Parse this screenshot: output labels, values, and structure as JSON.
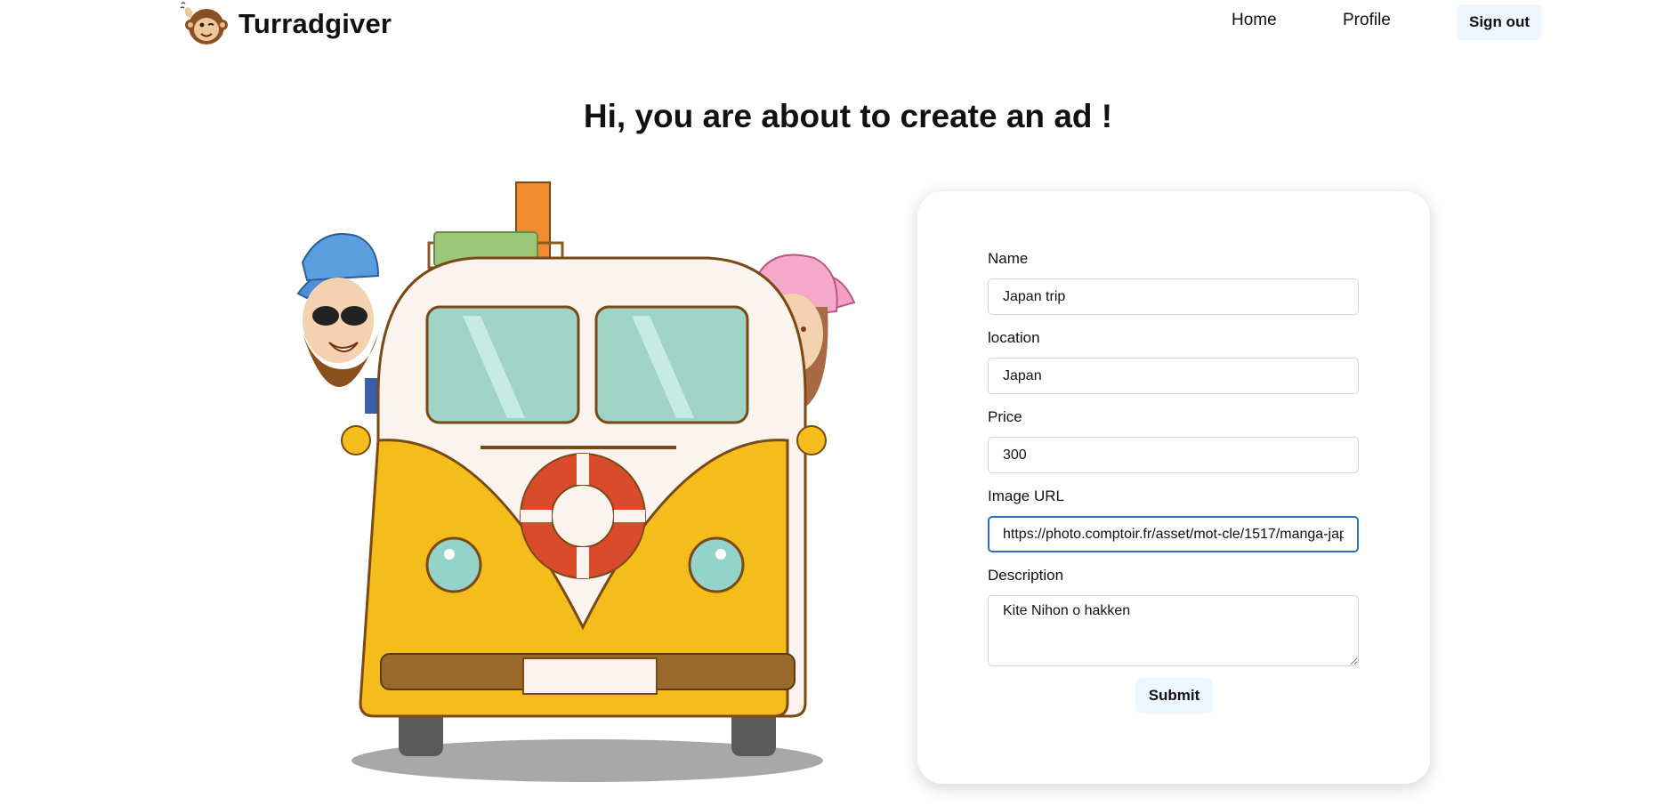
{
  "navbar": {
    "brand": "Turradgiver",
    "logo_icon": "monkey-logo-icon",
    "links": {
      "home": "Home",
      "profile": "Profile"
    },
    "signout_label": "Sign out",
    "button_bg": "#eef7ff"
  },
  "page": {
    "title": "Hi, you are about to create an ad !"
  },
  "illustration": {
    "icon": "van-travelers-illustration"
  },
  "form": {
    "fields": {
      "name": {
        "label": "Name",
        "value": "Japan trip"
      },
      "location": {
        "label": "location",
        "value": "Japan"
      },
      "price": {
        "label": "Price",
        "value": "300"
      },
      "image_url": {
        "label": "Image URL",
        "value": "https://photo.comptoir.fr/asset/mot-cle/1517/manga-jap"
      },
      "description": {
        "label": "Description",
        "value": "Kite Nihon o hakken"
      }
    },
    "submit_label": "Submit",
    "focus_color": "#2f6fb8"
  }
}
